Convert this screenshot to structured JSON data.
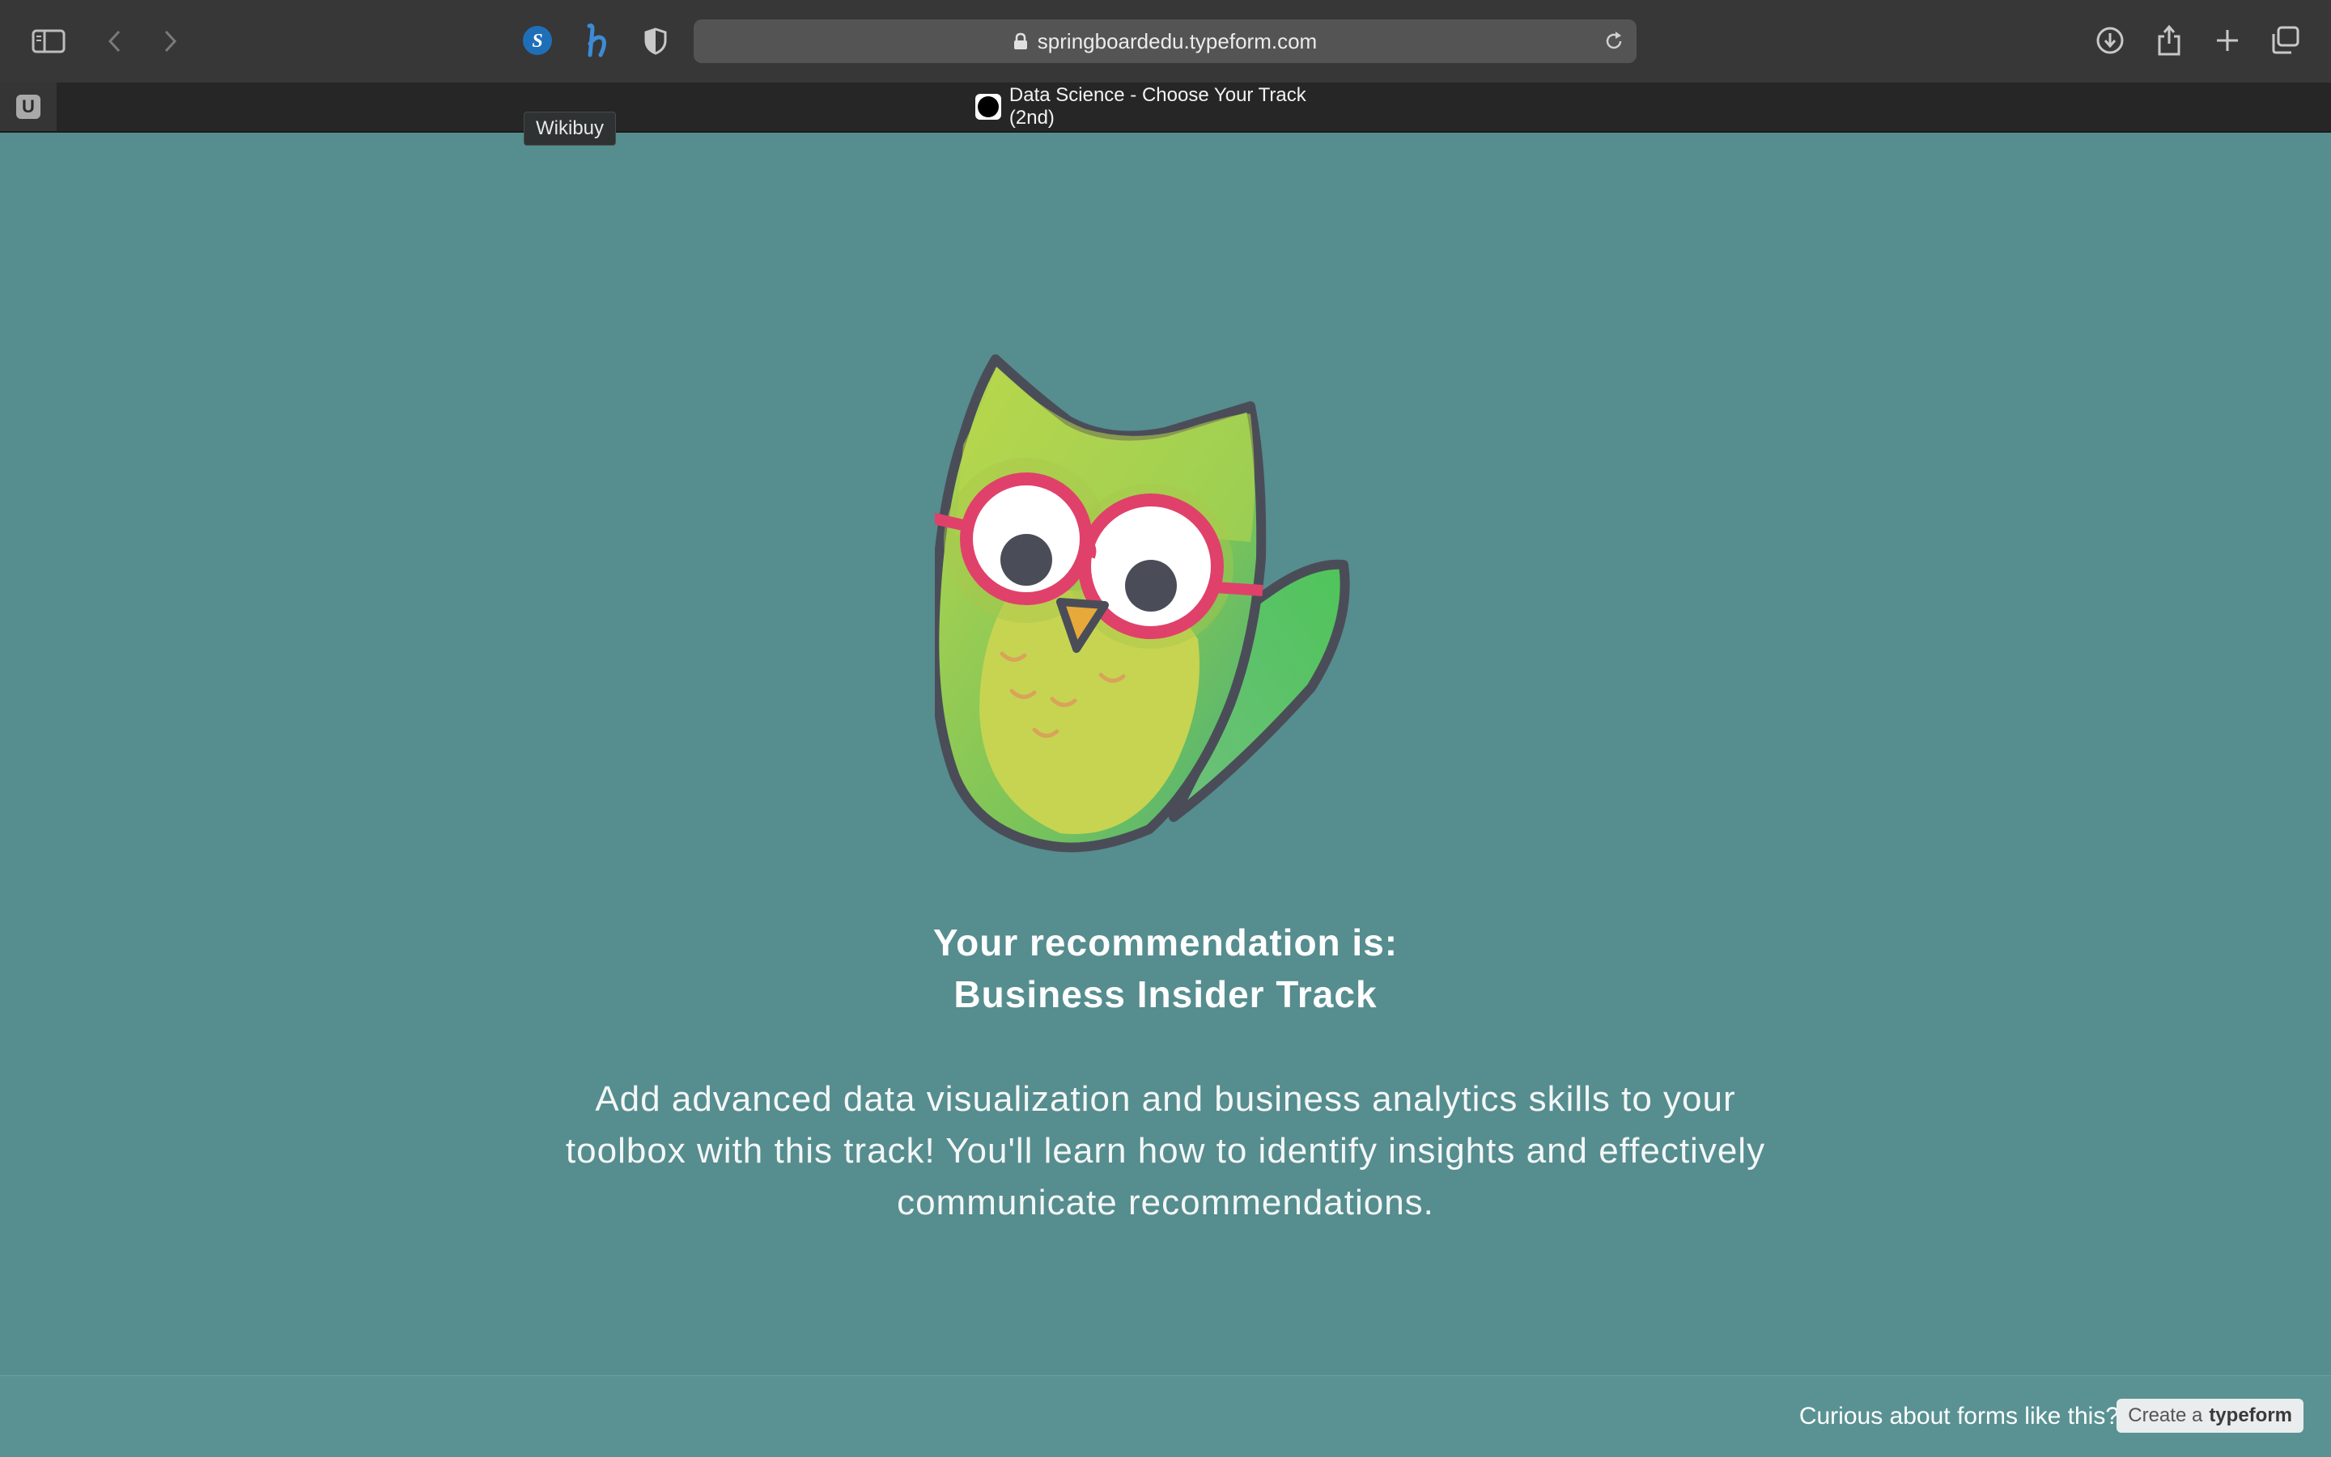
{
  "browser": {
    "url": "springboardedu.typeform.com",
    "pinned_tab_letter": "U",
    "active_tab_title": "Data Science - Choose Your Track (2nd)",
    "tooltip": "Wikibuy",
    "extensions": [
      "shopback-icon",
      "honey-icon",
      "privacy-shield-icon"
    ]
  },
  "result": {
    "heading_line1": "Your recommendation is:",
    "heading_line2": "Business Insider Track",
    "description": "Add advanced data visualization and business analytics skills to your toolbox with this track! You'll learn how to identify insights and effectively communicate recommendations."
  },
  "footer": {
    "prompt": "Curious about forms like this?",
    "button_prefix": "Create a",
    "button_brand": "typeform"
  },
  "colors": {
    "page_background": "#568d8f",
    "toolbar": "#373737",
    "owl_body": "#c6d452",
    "owl_glasses": "#e0416a"
  }
}
